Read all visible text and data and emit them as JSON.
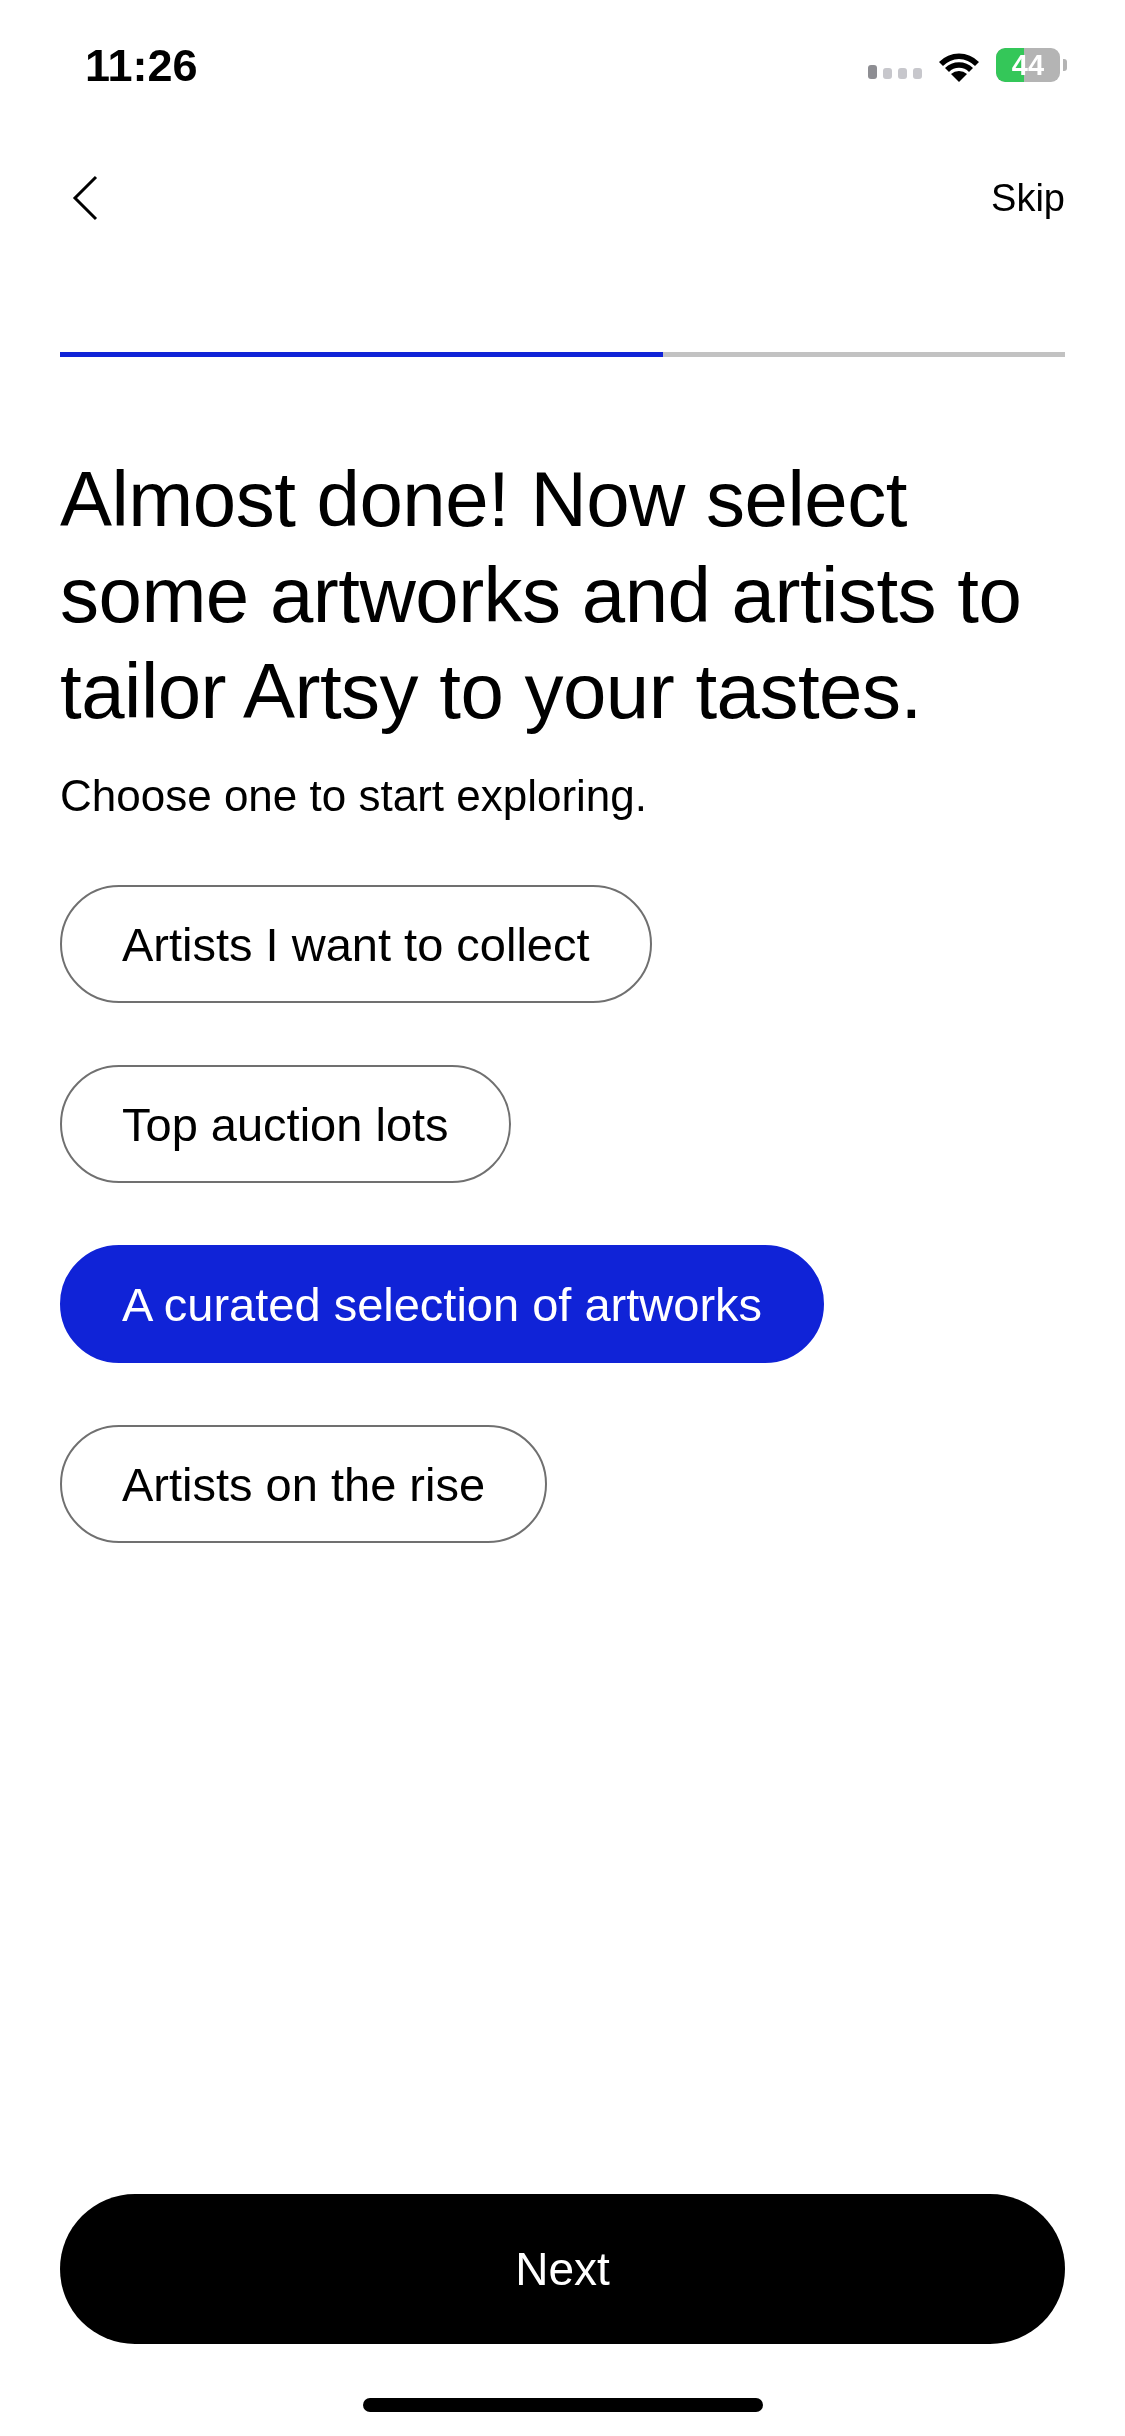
{
  "status_bar": {
    "time": "11:26",
    "battery": "44"
  },
  "nav": {
    "skip": "Skip"
  },
  "progress": {
    "level": 0.6
  },
  "title": "Almost done! Now select some artworks and artists to tailor Artsy to your tastes.",
  "subtitle": "Choose one to start exploring.",
  "options": [
    {
      "label": "Artists I want to collect",
      "selected": false
    },
    {
      "label": "Top auction lots",
      "selected": false
    },
    {
      "label": "A curated selection of artworks",
      "selected": true
    },
    {
      "label": "Artists on the rise",
      "selected": false
    }
  ],
  "next_button": "Next"
}
